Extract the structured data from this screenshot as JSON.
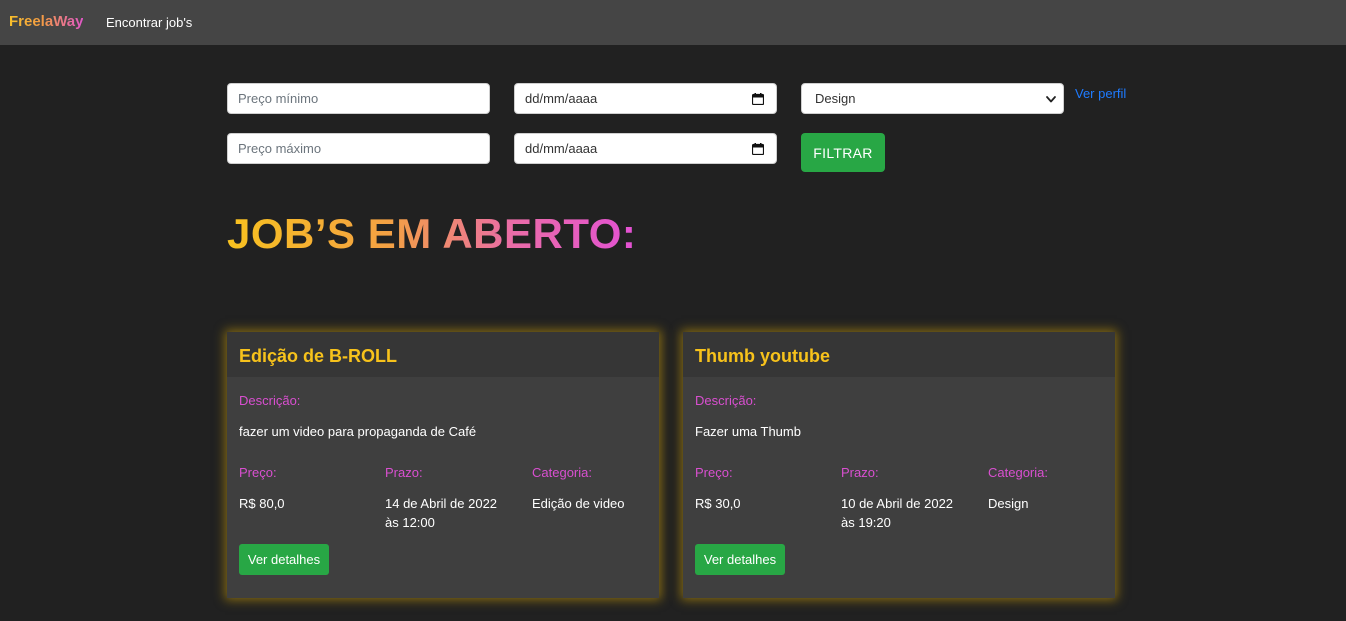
{
  "navbar": {
    "brand": "FreelaWay",
    "link": "Encontrar job's"
  },
  "filters": {
    "min_price_placeholder": "Preço mínimo",
    "max_price_placeholder": "Preço máximo",
    "date_start_value": "dd/mm/aaaa",
    "date_end_value": "dd/mm/aaaa",
    "category_selected": "Design",
    "profile_link": "Ver perfil",
    "filter_button": "FILTRAR"
  },
  "heading": "JOB’S EM ABERTO:",
  "labels": {
    "description": "Descrição:",
    "price": "Preço:",
    "deadline": "Prazo:",
    "category": "Categoria:",
    "details_button": "Ver detalhes"
  },
  "jobs": [
    {
      "title": "Edição de B-ROLL",
      "description": "fazer um video para propaganda de Café",
      "price": "R$ 80,0",
      "deadline_line1": "14 de Abril de 2022",
      "deadline_line2": "às 12:00",
      "category": "Edição de video"
    },
    {
      "title": "Thumb youtube",
      "description": "Fazer uma Thumb",
      "price": "R$ 30,0",
      "deadline_line1": "10 de Abril de 2022",
      "deadline_line2": "às 19:20",
      "category": "Design"
    }
  ],
  "colors": {
    "background": "#212121",
    "navbar": "#454545",
    "card": "#3f3f3f",
    "title_yellow": "#f7c21b",
    "label_magenta": "#d94fd0",
    "button_green": "#28a745",
    "link_blue": "#1e7bff"
  }
}
